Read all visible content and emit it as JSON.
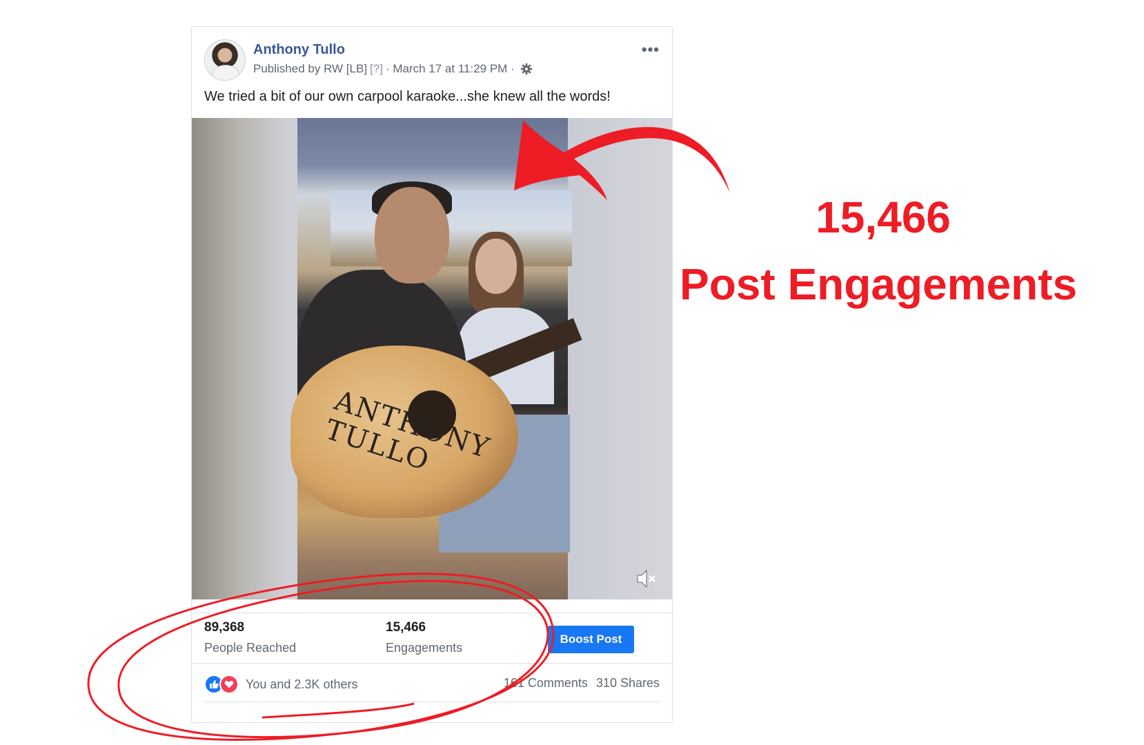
{
  "post": {
    "author": "Anthony Tullo",
    "published_by": "Published by RW [LB]",
    "help_marker": "[?]",
    "timestamp": "· March 17 at 11:29 PM ·",
    "caption": "We tried a bit of our own carpool karaoke...she knew all the words!",
    "more_label": "•••",
    "video_text": "ANTHONY TULLO"
  },
  "stats": {
    "people_reached": "89,368",
    "people_reached_label": "People Reached",
    "engagements": "15,466",
    "engagements_label": "Engagements",
    "boost_label": "Boost Post"
  },
  "reactions": {
    "summary": "You and 2.3K others",
    "comments": "161 Comments",
    "shares": "310 Shares"
  },
  "annotation": {
    "headline_number": "15,466",
    "headline_label": "Post Engagements",
    "accent_color": "#ee1c25"
  },
  "icons": [
    "avatar",
    "gear-icon",
    "more-icon",
    "mute-icon",
    "like-icon",
    "love-icon",
    "arrow-annotation",
    "circle-annotation"
  ],
  "colors": {
    "link": "#385898",
    "button": "#1877f2",
    "annotation": "#ee1c25"
  }
}
